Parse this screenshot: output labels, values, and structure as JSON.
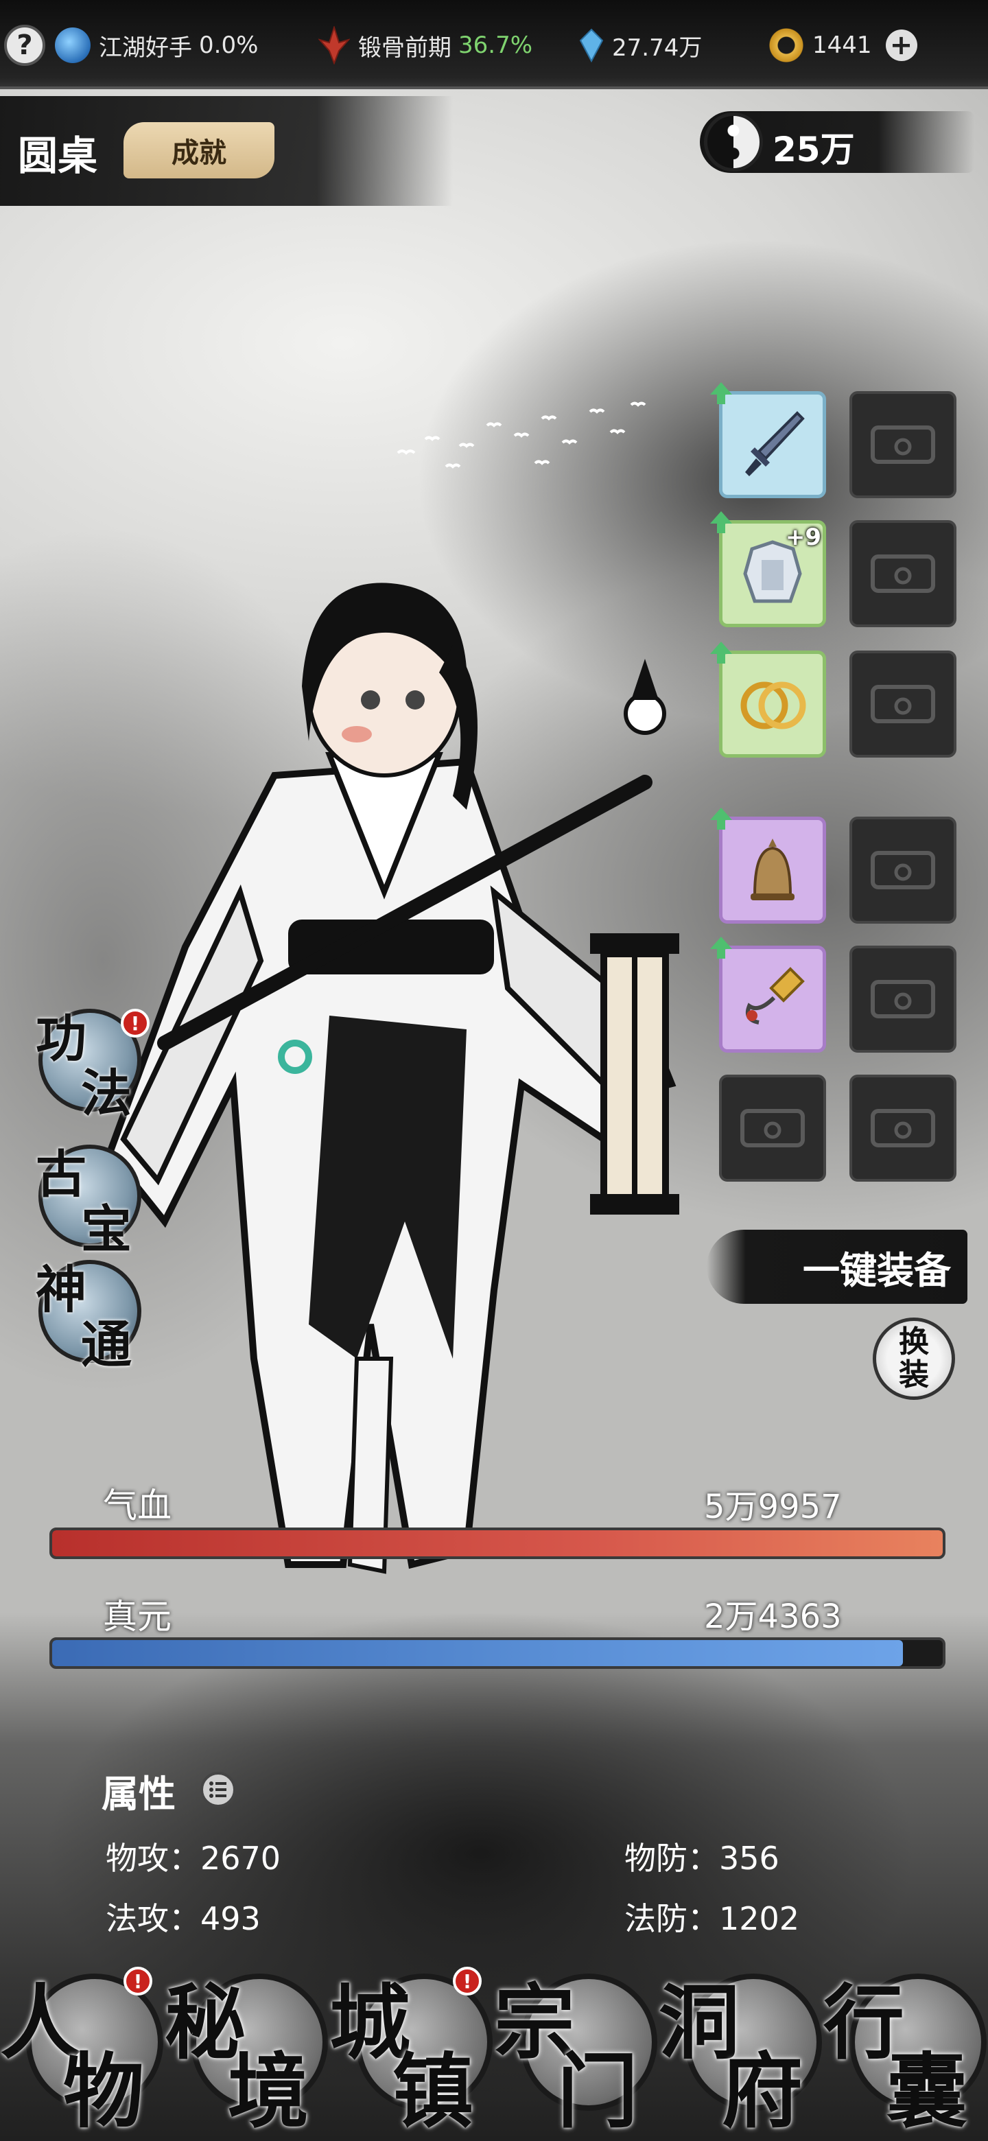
{
  "status_bar": {
    "help_label": "?",
    "rank": {
      "icon": "swirl-orb-icon",
      "name": "江湖好手",
      "progress": "0.0%"
    },
    "realm": {
      "icon": "flame-emblem-icon",
      "name": "锻骨前期",
      "progress": "36.7%"
    },
    "spirit_stones": {
      "icon": "crystal-icon",
      "value": "27.74万"
    },
    "gold_ingots": {
      "icon": "gold-ring-icon",
      "value": "1441"
    },
    "add_label": "+"
  },
  "header": {
    "title": "圆桌",
    "achievement_label": "成就",
    "currency_value": "25万",
    "currency_icon": "taiji-icon"
  },
  "equipment": [
    {
      "slot": 1,
      "item_icon": "dagger-icon",
      "rarity": "blue",
      "upgrade": true,
      "level": ""
    },
    {
      "slot": 2,
      "item_icon": "armor-icon",
      "rarity": "green",
      "upgrade": true,
      "level": "+9"
    },
    {
      "slot": 3,
      "item_icon": "gold-rings-icon",
      "rarity": "green",
      "upgrade": true,
      "level": ""
    },
    {
      "slot": 4,
      "item_icon": "bell-icon",
      "rarity": "purple",
      "upgrade": true,
      "level": ""
    },
    {
      "slot": 5,
      "item_icon": "flail-icon",
      "rarity": "purple",
      "upgrade": true,
      "level": ""
    },
    {
      "slot": 6,
      "item_icon": "empty-slot-icon",
      "rarity": "empty",
      "upgrade": false,
      "level": ""
    }
  ],
  "side_menu": [
    {
      "char1": "功",
      "char2": "法",
      "notification": true
    },
    {
      "char1": "古",
      "char2": "宝",
      "notification": false
    },
    {
      "char1": "神",
      "char2": "通",
      "notification": false
    }
  ],
  "actions": {
    "one_key_equip": "一键装备",
    "swap_char1": "换",
    "swap_char2": "装"
  },
  "stats": {
    "hp": {
      "label": "气血",
      "value": "5万9957",
      "fill_fraction": 1.0,
      "color": "#d6574b"
    },
    "mp": {
      "label": "真元",
      "value": "2万4363",
      "fill_fraction": 0.955,
      "color": "#5a8fd6"
    }
  },
  "attributes": {
    "title": "属性",
    "items": [
      {
        "label": "物攻：",
        "value": "2670"
      },
      {
        "label": "物防：",
        "value": "356"
      },
      {
        "label": "法攻：",
        "value": "493"
      },
      {
        "label": "法防：",
        "value": "1202"
      }
    ]
  },
  "bottom_nav": [
    {
      "char1": "人",
      "char2": "物",
      "notification": true
    },
    {
      "char1": "秘",
      "char2": "境",
      "notification": false
    },
    {
      "char1": "城",
      "char2": "镇",
      "notification": true
    },
    {
      "char1": "宗",
      "char2": "门",
      "notification": false
    },
    {
      "char1": "洞",
      "char2": "府",
      "notification": false
    },
    {
      "char1": "行",
      "char2": "囊",
      "notification": false
    }
  ],
  "notif_mark": "!"
}
